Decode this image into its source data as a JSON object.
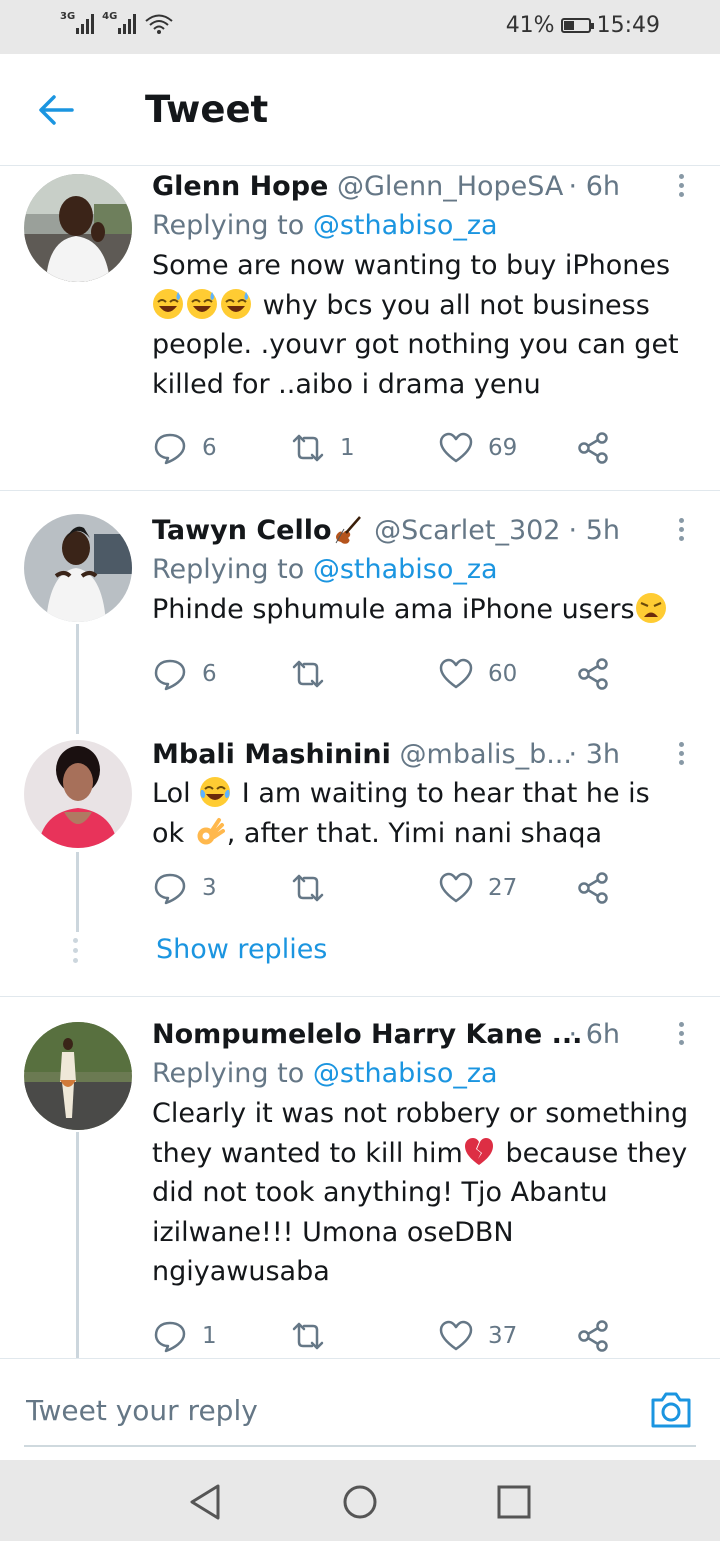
{
  "status_bar": {
    "network1": "3G",
    "network2": "4G",
    "battery_percent": "41%",
    "battery_level": 0.41,
    "time": "15:49"
  },
  "header": {
    "title": "Tweet"
  },
  "tweets": [
    {
      "name": "Glenn Hope",
      "handle": "@Glenn_HopeSA",
      "time": "· 6h",
      "replying_prefix": "Replying to",
      "replying_to": "@sthabiso_za",
      "text_lines": [
        "Some are now wanting to buy iPhones",
        "why bcs you all not business",
        "people. .youvr got nothing you can get",
        "killed for ..aibo i drama yenu"
      ],
      "replies": "6",
      "retweets": "1",
      "likes": "69"
    },
    {
      "name": "Tawyn Cello",
      "handle": "@Scarlet_302",
      "time": "· 5h",
      "replying_prefix": "Replying to",
      "replying_to": "@sthabiso_za",
      "text_lines": [
        "Phinde sphumule ama iPhone users"
      ],
      "replies": "6",
      "retweets": "",
      "likes": "60"
    },
    {
      "name": "Mbali Mashinini",
      "handle": "@mbalis_b...",
      "time": "· 3h",
      "text_lines": [
        "Lol",
        "I am waiting to hear that he is",
        "ok",
        ", after that. Yimi nani shaqa"
      ],
      "replies": "3",
      "retweets": "",
      "likes": "27",
      "show_replies": "Show replies"
    },
    {
      "name": "Nompumelelo Harry Kane ...",
      "time": "· 6h",
      "replying_prefix": "Replying to",
      "replying_to": "@sthabiso_za",
      "text_lines": [
        "Clearly it was not robbery or something",
        "they wanted to kill him",
        "because they",
        "did not took anything! Tjo Abantu",
        "izilwane!!! Umona oseDBN",
        "ngiyawusaba"
      ],
      "replies": "1",
      "retweets": "",
      "likes": "37"
    }
  ],
  "reply_bar": {
    "placeholder": "Tweet your reply"
  },
  "colors": {
    "accent": "#1b95e0",
    "text": "#14171a",
    "secondary": "#657786",
    "border": "#e1e8ed"
  },
  "icons": [
    "back-arrow-icon",
    "more-icon",
    "reply-icon",
    "retweet-icon",
    "like-icon",
    "share-icon",
    "camera-icon",
    "nav-back-icon",
    "nav-home-icon",
    "nav-recents-icon"
  ]
}
